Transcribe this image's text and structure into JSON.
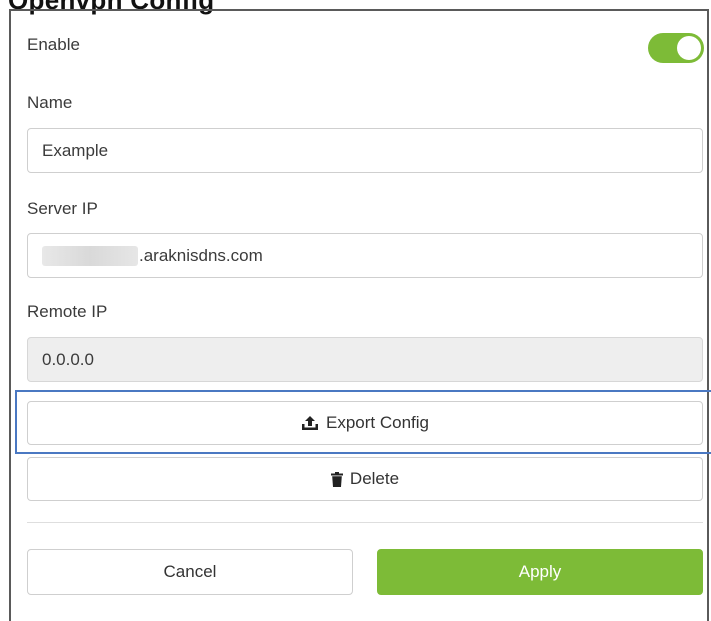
{
  "header": {
    "title": "Openvpn Config"
  },
  "form": {
    "enable": {
      "label": "Enable",
      "on": true,
      "color": "#7dbb37"
    },
    "name": {
      "label": "Name",
      "value": "Example"
    },
    "server_ip": {
      "label": "Server IP",
      "value_suffix": ".araknisdns.com"
    },
    "remote_ip": {
      "label": "Remote IP",
      "value": "0.0.0.0"
    }
  },
  "actions": {
    "export_label": "Export Config",
    "delete_label": "Delete",
    "cancel_label": "Cancel",
    "apply_label": "Apply"
  },
  "icons": {
    "export": "upload-icon",
    "delete": "trash-icon"
  },
  "colors": {
    "accent": "#7dbb37",
    "focus": "#4a78c2"
  }
}
